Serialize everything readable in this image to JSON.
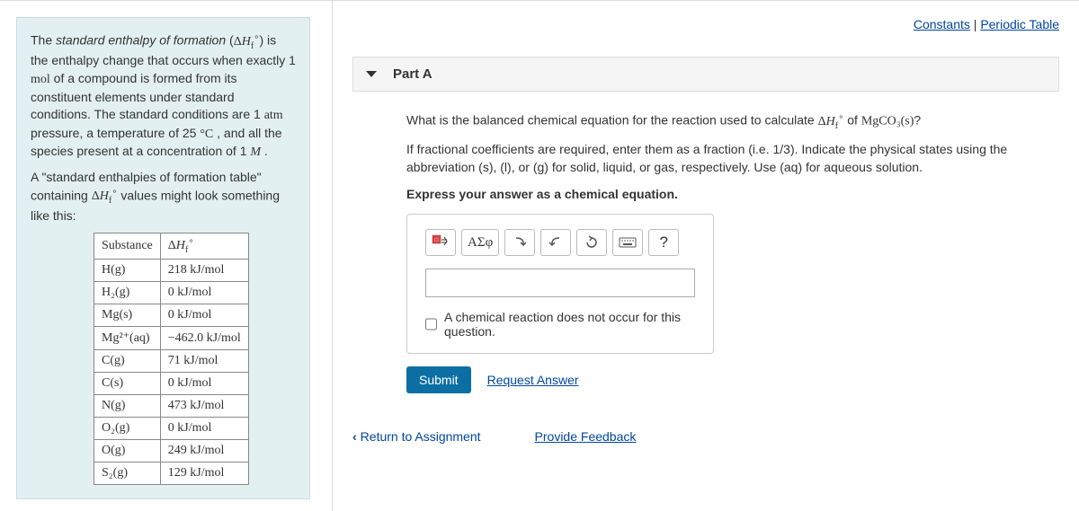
{
  "links": {
    "constants": "Constants",
    "separator": " | ",
    "periodic_table": "Periodic Table"
  },
  "intro": {
    "sentence1_pre": "The ",
    "sentence1_term": "standard enthalpy of formation",
    "sentence1_mid": " (",
    "sentence1_post": ") is the enthalpy change that occurs when exactly 1 ",
    "mol": "mol",
    "sentence1_end": " of a compound is formed from its constituent elements under standard conditions. The standard conditions are 1 ",
    "atm": "atm",
    "sentence1_tail": " pressure, a temperature of 25 ",
    "degC": "°C",
    "sentence1_tail2": " , and all the species present at a concentration of 1 ",
    "M": "M",
    "sentence1_tail3": " .",
    "sentence2_pre": "A \"standard enthalpies of formation table\" containing ",
    "sentence2_post": " values might look something like this:"
  },
  "delta_h_symbol": "ΔH",
  "table": {
    "col1": "Substance",
    "col2_pre": "ΔH",
    "rows": [
      {
        "sub": "H(g)",
        "val": "218 kJ/mol"
      },
      {
        "sub": "H₂(g)",
        "val": "0 kJ/mol"
      },
      {
        "sub": "Mg(s)",
        "val": "0 kJ/mol"
      },
      {
        "sub": "Mg²⁺(aq)",
        "val": "−462.0 kJ/mol"
      },
      {
        "sub": "C(g)",
        "val": "71 kJ/mol"
      },
      {
        "sub": "C(s)",
        "val": "0 kJ/mol"
      },
      {
        "sub": "N(g)",
        "val": "473 kJ/mol"
      },
      {
        "sub": "O₂(g)",
        "val": "0 kJ/mol"
      },
      {
        "sub": "O(g)",
        "val": "249 kJ/mol"
      },
      {
        "sub": "S₂(g)",
        "val": "129 kJ/mol"
      }
    ]
  },
  "part": {
    "title": "Part A",
    "q1_pre": "What is the balanced chemical equation for the reaction used to calculate ",
    "q1_post": " of ",
    "compound": "MgCO₃(s)",
    "q1_end": "?",
    "q2": "If fractional coefficients are required, enter them as a fraction (i.e. 1/3). Indicate the physical states using the abbreviation (s), (l), or (g) for solid, liquid, or gas, respectively. Use (aq) for aqueous solution.",
    "q3": "Express your answer as a chemical equation.",
    "greek_label": "ΑΣφ",
    "help_label": "?",
    "checkbox_label": "A chemical reaction does not occur for this question.",
    "submit": "Submit",
    "request": "Request Answer"
  },
  "footer": {
    "return": "Return to Assignment",
    "feedback": "Provide Feedback"
  }
}
